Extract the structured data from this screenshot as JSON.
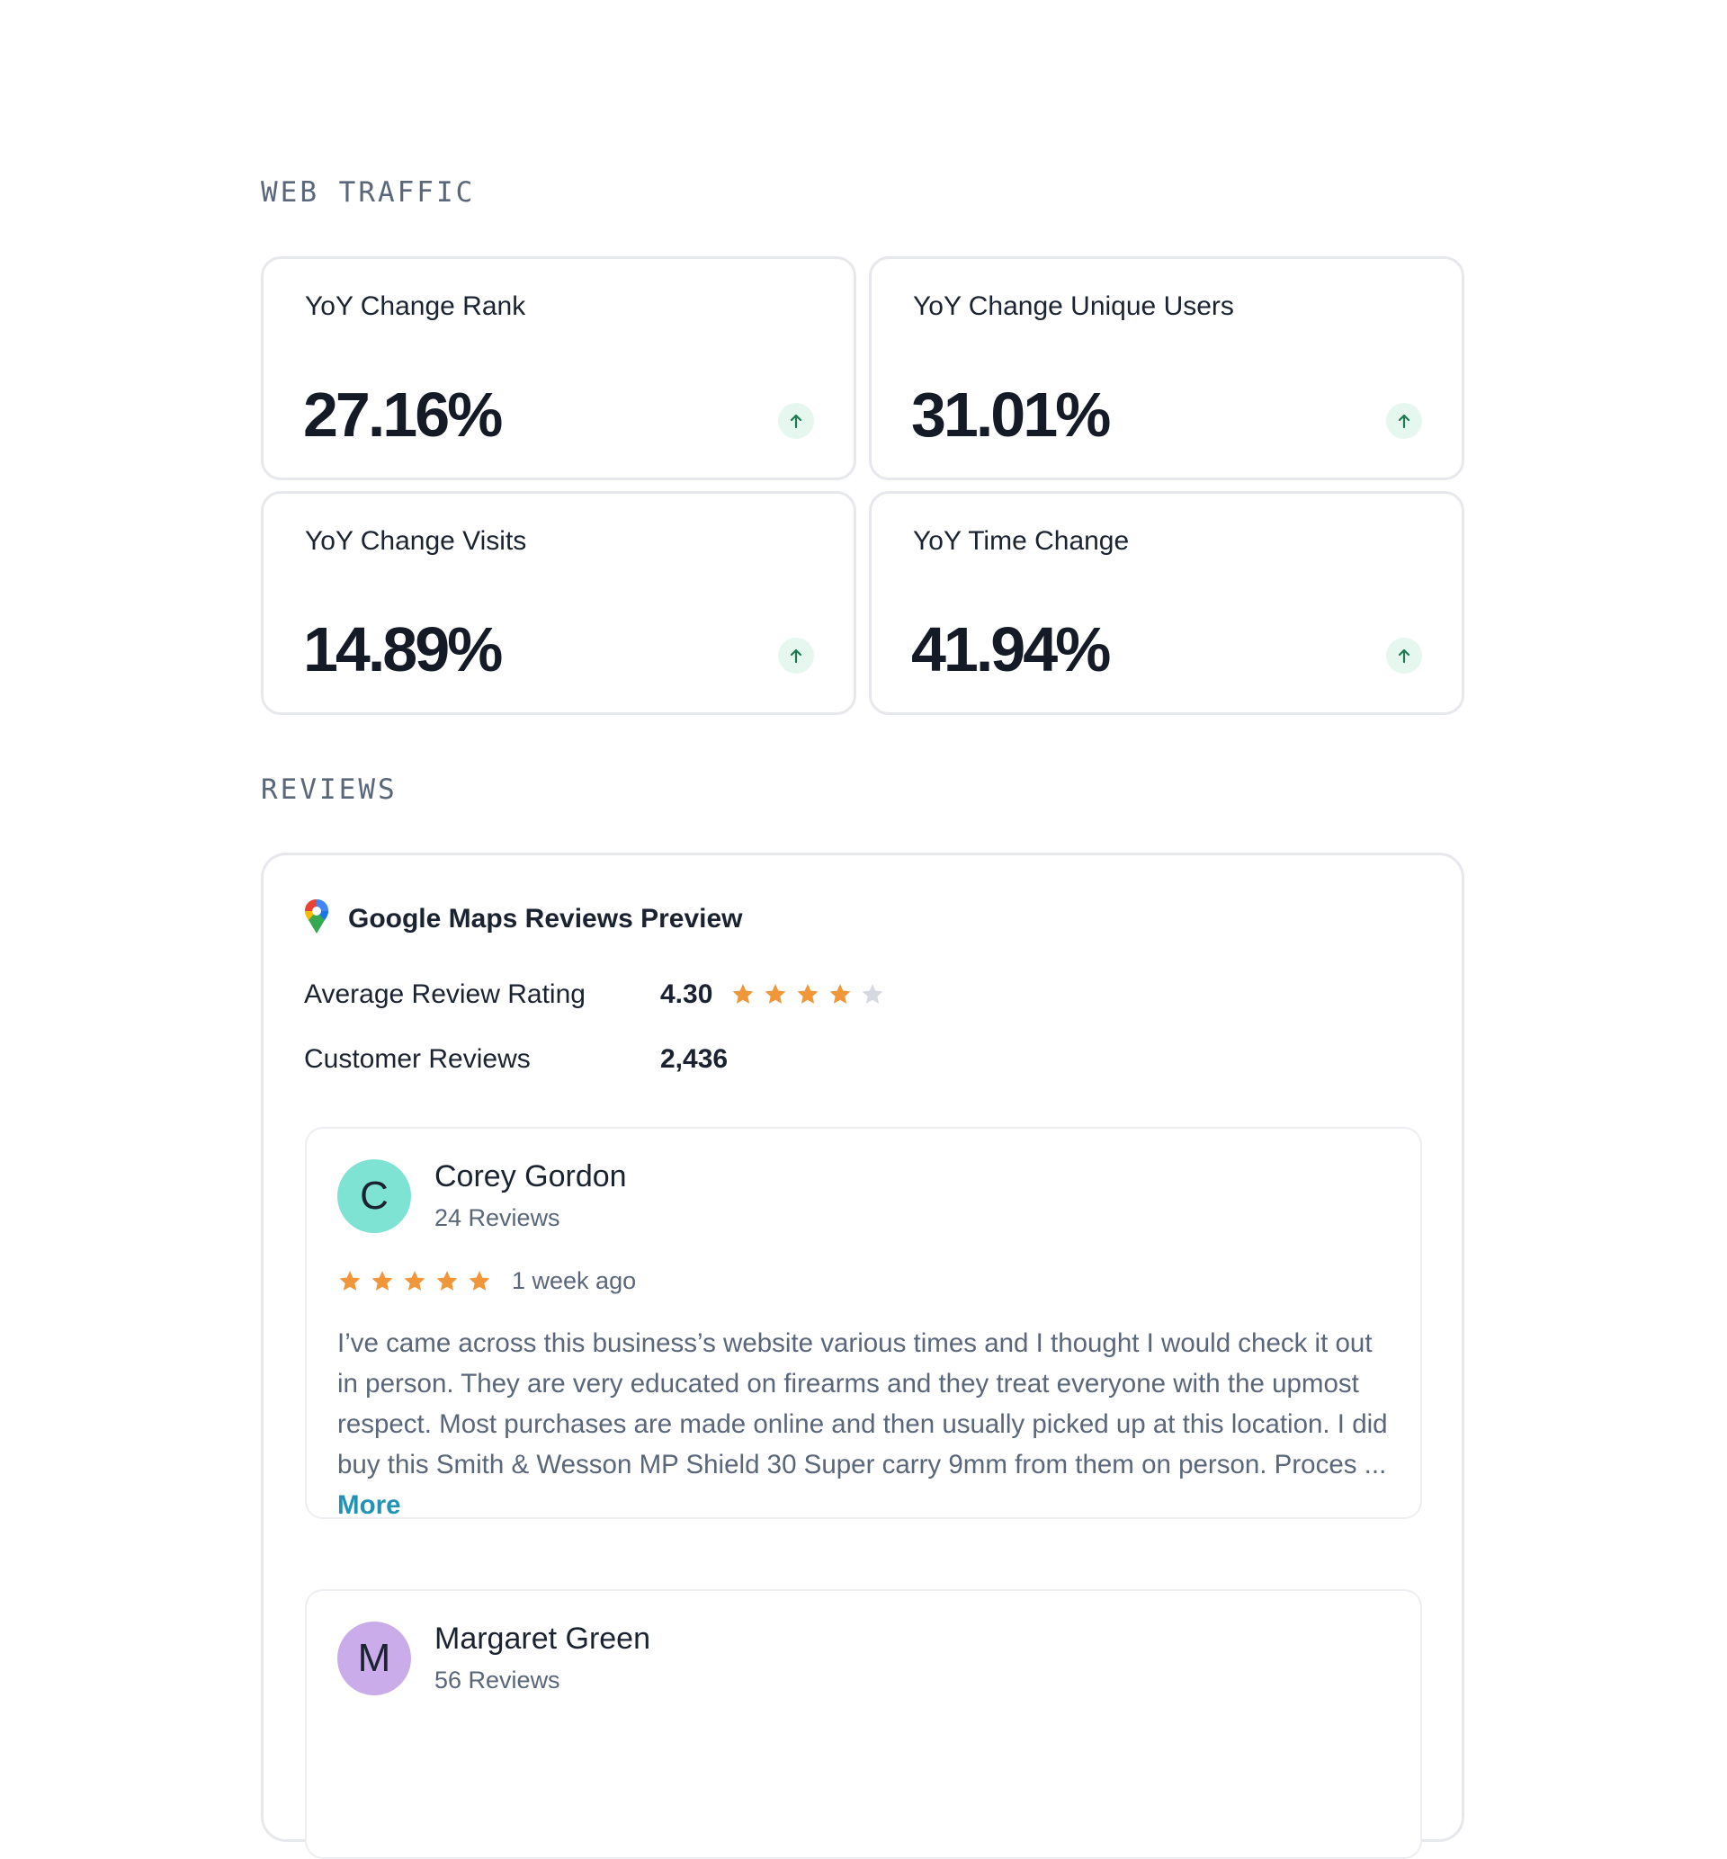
{
  "web_traffic": {
    "section_title": "WEB TRAFFIC",
    "metrics": [
      {
        "label": "YoY Change Rank",
        "value": "27.16%",
        "trend": "up",
        "trend_icon": "arrow-up-icon"
      },
      {
        "label": "YoY Change Unique Users",
        "value": "31.01%",
        "trend": "up",
        "trend_icon": "arrow-up-icon"
      },
      {
        "label": "YoY Change Visits",
        "value": "14.89%",
        "trend": "up",
        "trend_icon": "arrow-up-icon"
      },
      {
        "label": "YoY Time Change",
        "value": "41.94%",
        "trend": "up",
        "trend_icon": "arrow-up-icon"
      }
    ]
  },
  "reviews": {
    "section_title": "REVIEWS",
    "source_icon": "google-maps-pin-icon",
    "source_title": "Google Maps Reviews Preview",
    "average_rating_label": "Average Review Rating",
    "average_rating_value": "4.30",
    "average_rating_stars": 4,
    "customer_reviews_label": "Customer Reviews",
    "customer_reviews_value": "2,436",
    "items": [
      {
        "avatar_letter": "C",
        "avatar_color": "#7ee3d2",
        "name": "Corey Gordon",
        "review_count": "24 Reviews",
        "stars": 5,
        "time": "1 week ago",
        "text": "I’ve came across this business’s website various times and I thought I would check it out in person. They are very educated on firearms and they treat everyone with the upmost respect. Most purchases are made online and then usually picked up at this location. I did buy this Smith & Wesson MP Shield 30 Super carry 9mm from them on person. Proces ... ",
        "more_label": "More"
      },
      {
        "avatar_letter": "M",
        "avatar_color": "#c9ace9",
        "name": "Margaret Green",
        "review_count": "56 Reviews"
      }
    ]
  },
  "colors": {
    "star_filled": "#f0973a",
    "star_empty": "#d6dae0",
    "trend_up": "#1f7a52",
    "link": "#2293b5"
  }
}
